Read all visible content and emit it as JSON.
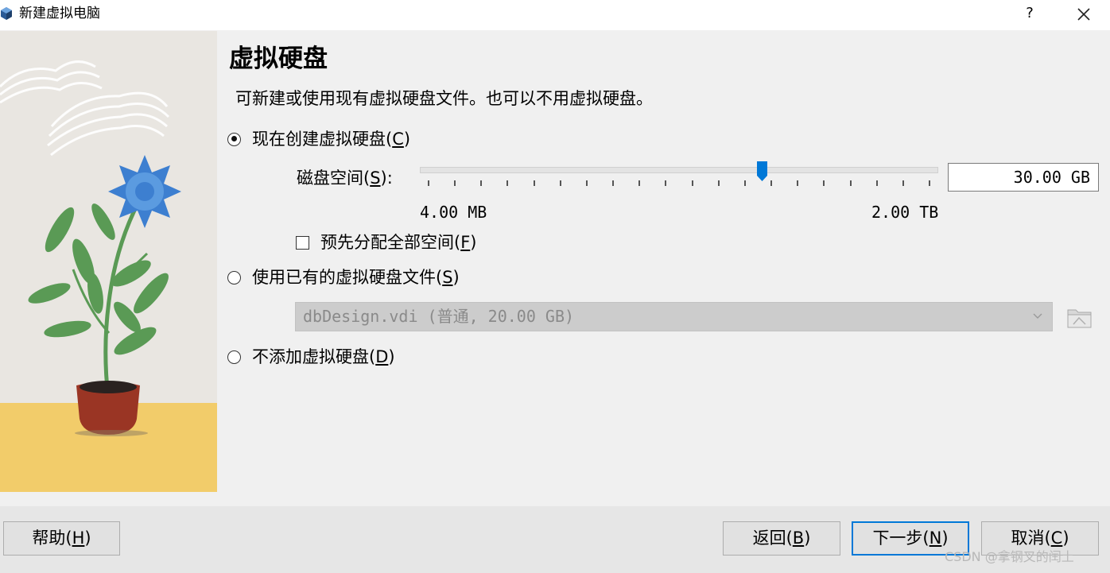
{
  "window": {
    "title": "新建虚拟电脑",
    "help_glyph": "?"
  },
  "page": {
    "heading": "虚拟硬盘",
    "subtitle": "可新建或使用现有虚拟硬盘文件。也可以不用虚拟硬盘。"
  },
  "options": {
    "create_now": {
      "text": "现在创建虚拟硬盘(",
      "key": "C",
      "end": ")",
      "checked": true
    },
    "use_existing": {
      "text": "使用已有的虚拟硬盘文件(",
      "key": "S",
      "end": ")",
      "checked": false
    },
    "no_disk": {
      "text": "不添加虚拟硬盘(",
      "key": "D",
      "end": ")",
      "checked": false
    }
  },
  "disk_size": {
    "label_text": "磁盘空间(",
    "label_key": "S",
    "label_end": "):",
    "value": "30.00 GB",
    "min_label": "4.00 MB",
    "max_label": "2.00 TB",
    "slider_fraction": 0.667
  },
  "preallocate": {
    "text": "预先分配全部空间(",
    "key": "F",
    "end": ")",
    "checked": false
  },
  "existing_disk": {
    "selected": "dbDesign.vdi (普通, 20.00 GB)"
  },
  "buttons": {
    "help": {
      "text": "帮助(",
      "key": "H",
      "end": ")"
    },
    "back": {
      "text": "返回(",
      "key": "B",
      "end": ")"
    },
    "next": {
      "text": "下一步(",
      "key": "N",
      "end": ")"
    },
    "cancel": {
      "text": "取消(",
      "key": "C",
      "end": ")"
    }
  },
  "watermark": "CSDN @拿钢叉的闰土",
  "colors": {
    "accent": "#0078d7",
    "illustration_bg": "#e9e6e1",
    "illustration_floor": "#f2cc6a",
    "flower": "#3d7fd0",
    "leaf": "#5a9a55",
    "pot": "#9a3524"
  },
  "icons": [
    "app-icon",
    "help-icon",
    "close-icon",
    "chevron-down-icon",
    "folder-icon"
  ]
}
